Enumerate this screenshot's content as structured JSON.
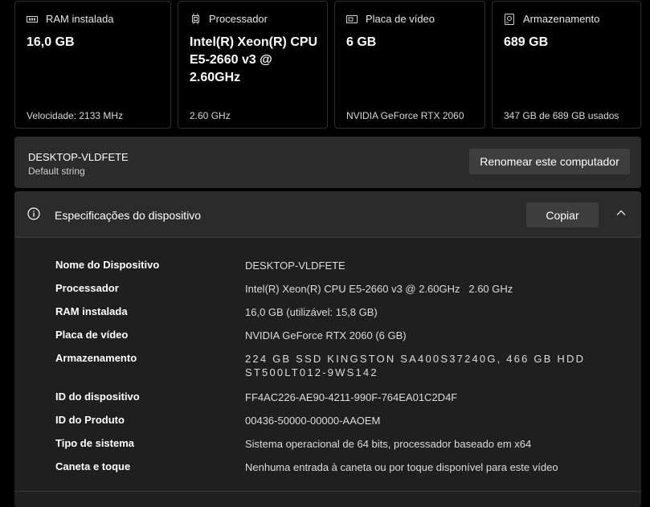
{
  "cards": [
    {
      "icon": "ram-icon",
      "label": "RAM instalada",
      "value": "16,0 GB",
      "footer": "Velocidade: 2133 MHz"
    },
    {
      "icon": "processor-icon",
      "label": "Processador",
      "value": "Intel(R) Xeon(R) CPU E5-2660 v3 @ 2.60GHz",
      "footer": "2.60 GHz"
    },
    {
      "icon": "gpu-icon",
      "label": "Placa de vídeo",
      "value": "6 GB",
      "footer": "NVIDIA GeForce RTX 2060"
    },
    {
      "icon": "storage-icon",
      "label": "Armazenamento",
      "value": "689 GB",
      "footer": "347 GB de 689 GB usados"
    }
  ],
  "computer": {
    "name": "DESKTOP-VLDFETE",
    "subtitle": "Default string",
    "rename_label": "Renomear este computador"
  },
  "specs": {
    "title": "Especificações do dispositivo",
    "copy_label": "Copiar",
    "rows": [
      {
        "key": "Nome do Dispositivo",
        "value": "DESKTOP-VLDFETE"
      },
      {
        "key": "Processador",
        "value": "Intel(R) Xeon(R) CPU E5-2660 v3 @ 2.60GHz   2.60 GHz"
      },
      {
        "key": "RAM instalada",
        "value": "16,0 GB (utilizável: 15,8 GB)"
      },
      {
        "key": "Placa de vídeo",
        "value": "NVIDIA GeForce RTX 2060 (6 GB)"
      },
      {
        "key": "Armazenamento",
        "value": "224 GB SSD KINGSTON SA400S37240G, 466 GB HDD ST500LT012-9WS142"
      },
      {
        "key": "ID do dispositivo",
        "value": "FF4AC226-AE90-4211-990F-764EA01C2D4F"
      },
      {
        "key": "ID do Produto",
        "value": "00436-50000-00000-AAOEM"
      },
      {
        "key": "Tipo de sistema",
        "value": "Sistema operacional de 64 bits, processador baseado em x64"
      },
      {
        "key": "Caneta e toque",
        "value": "Nenhuma entrada à caneta ou por toque disponível para este vídeo"
      }
    ]
  }
}
